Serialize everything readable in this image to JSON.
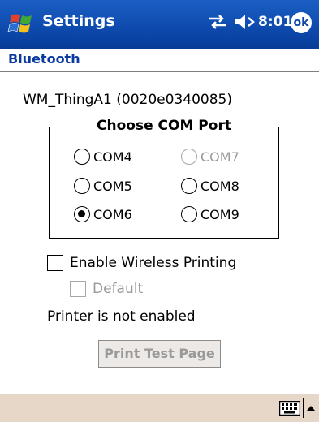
{
  "titlebar": {
    "title": "Settings",
    "icons": [
      "windows-start-icon",
      "sync-icon",
      "volume-icon"
    ],
    "clock": "8:01",
    "ok_label": "ok"
  },
  "header": {
    "title": "Bluetooth"
  },
  "device": {
    "name": "WM_ThingA1 (0020e0340085)"
  },
  "com_port": {
    "legend": "Choose COM Port",
    "options": [
      {
        "label": "COM4",
        "selected": false,
        "enabled": true
      },
      {
        "label": "COM7",
        "selected": false,
        "enabled": false
      },
      {
        "label": "COM5",
        "selected": false,
        "enabled": true
      },
      {
        "label": "COM8",
        "selected": false,
        "enabled": true
      },
      {
        "label": "COM6",
        "selected": true,
        "enabled": true
      },
      {
        "label": "COM9",
        "selected": false,
        "enabled": true
      }
    ]
  },
  "printing": {
    "enable_label": "Enable Wireless Printing",
    "enable_checked": false,
    "default_label": "Default",
    "default_checked": false,
    "default_enabled": false,
    "status": "Printer is not enabled",
    "test_button": "Print Test Page"
  },
  "bottombar": {
    "icons": [
      "keyboard-icon",
      "sip-arrow-up-icon"
    ]
  },
  "colors": {
    "titlebar": "#0b46a8",
    "header_text": "#0a3aa0",
    "bottombar": "#e6d7c8",
    "disabled_text": "#9a9a9a"
  }
}
